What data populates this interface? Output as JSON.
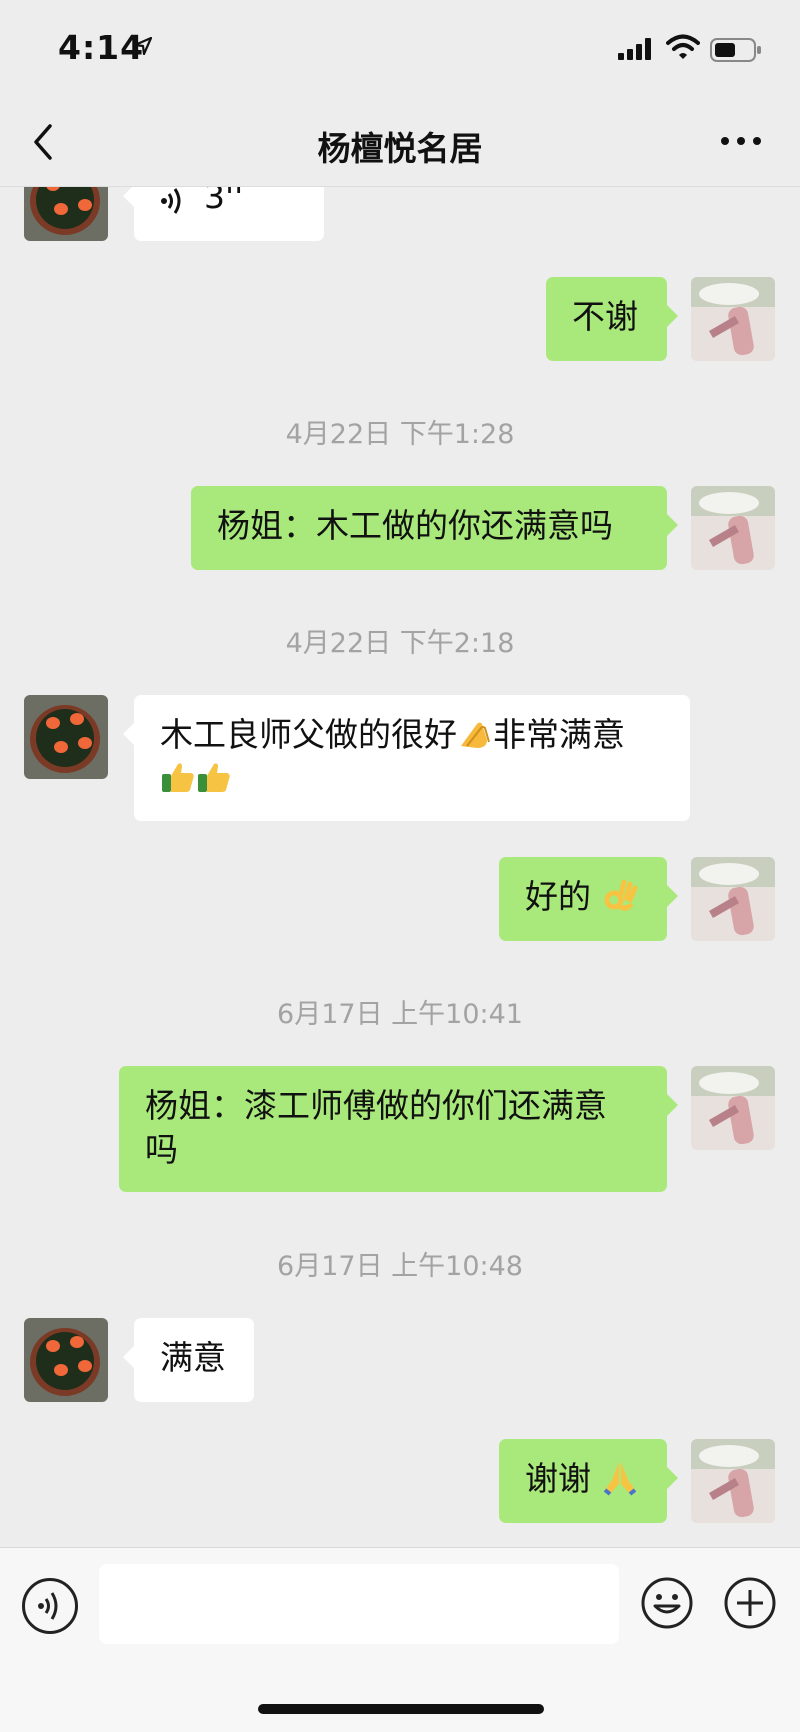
{
  "status_bar": {
    "time": "4:14",
    "icons": [
      "location-arrow-icon",
      "signal-icon",
      "wifi-icon",
      "battery-icon"
    ]
  },
  "nav": {
    "title": "杨檀悦名居",
    "back_icon": "chevron-left-icon",
    "more_icon": "more-dots-icon"
  },
  "messages": [
    {
      "type": "voice",
      "side": "left",
      "duration": "3''"
    },
    {
      "type": "text",
      "side": "right",
      "text": "不谢"
    },
    {
      "type": "timestamp",
      "text": "4月22日 下午1:28"
    },
    {
      "type": "text",
      "side": "right",
      "text": "杨姐：木工做的你还满意吗"
    },
    {
      "type": "timestamp",
      "text": "4月22日 下午2:18"
    },
    {
      "type": "text",
      "side": "left",
      "line1": "木工良师父做的很好",
      "line1b": "非常满意",
      "emojis": [
        "clapping-hands-emoji",
        "thumbs-up-emoji",
        "thumbs-up-emoji"
      ]
    },
    {
      "type": "text",
      "side": "right",
      "text": "好的",
      "emoji": "ok-hand-emoji"
    },
    {
      "type": "timestamp",
      "text": "6月17日 上午10:41"
    },
    {
      "type": "text",
      "side": "right",
      "line1": "杨姐：漆工师傅做的你们还满意",
      "line2": "吗"
    },
    {
      "type": "timestamp",
      "text": "6月17日 上午10:48"
    },
    {
      "type": "text",
      "side": "left",
      "text": "满意"
    },
    {
      "type": "text",
      "side": "right",
      "text": "谢谢",
      "emoji": "folded-hands-emoji"
    }
  ],
  "input_bar": {
    "placeholder": "",
    "voice_icon": "voice-icon",
    "emoji_icon": "smiley-icon",
    "plus_icon": "plus-icon"
  },
  "colors": {
    "background": "#ededed",
    "outgoing_bubble": "#a9e97b",
    "incoming_bubble": "#ffffff",
    "timestamp": "#a3a3a3"
  }
}
